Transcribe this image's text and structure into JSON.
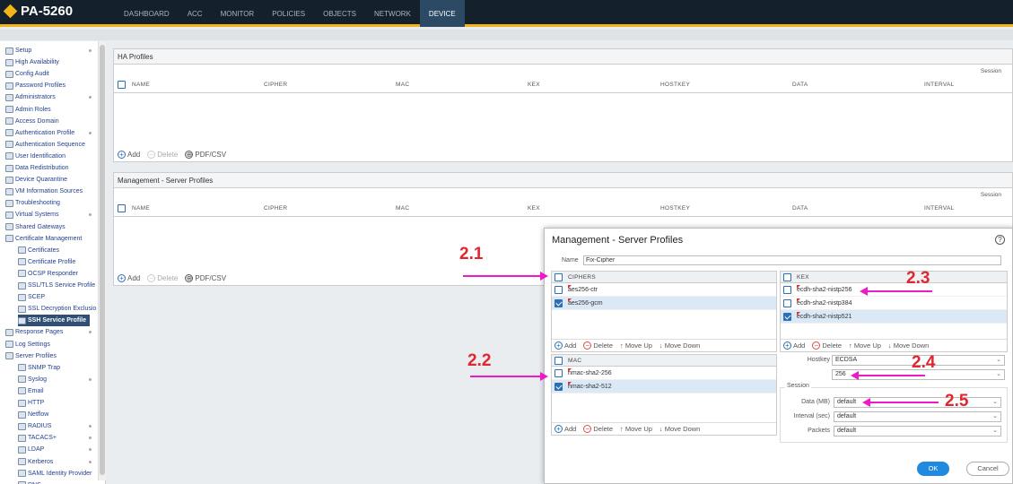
{
  "app": {
    "device_name": "PA-5260"
  },
  "nav": {
    "tabs": [
      "DASHBOARD",
      "ACC",
      "MONITOR",
      "POLICIES",
      "OBJECTS",
      "NETWORK",
      "DEVICE"
    ],
    "active": "DEVICE"
  },
  "sidebar": {
    "items": [
      {
        "label": "Setup"
      },
      {
        "label": "High Availability"
      },
      {
        "label": "Config Audit"
      },
      {
        "label": "Password Profiles"
      },
      {
        "label": "Administrators"
      },
      {
        "label": "Admin Roles"
      },
      {
        "label": "Access Domain"
      },
      {
        "label": "Authentication Profile"
      },
      {
        "label": "Authentication Sequence"
      },
      {
        "label": "User Identification"
      },
      {
        "label": "Data Redistribution"
      },
      {
        "label": "Device Quarantine"
      },
      {
        "label": "VM Information Sources"
      },
      {
        "label": "Troubleshooting"
      },
      {
        "label": "Virtual Systems"
      },
      {
        "label": "Shared Gateways"
      },
      {
        "label": "Certificate Management"
      },
      {
        "label": "Certificates"
      },
      {
        "label": "Certificate Profile"
      },
      {
        "label": "OCSP Responder"
      },
      {
        "label": "SSL/TLS Service Profile"
      },
      {
        "label": "SCEP"
      },
      {
        "label": "SSL Decryption Exclusio"
      },
      {
        "label": "SSH Service Profile"
      },
      {
        "label": "Response Pages"
      },
      {
        "label": "Log Settings"
      },
      {
        "label": "Server Profiles"
      },
      {
        "label": "SNMP Trap"
      },
      {
        "label": "Syslog"
      },
      {
        "label": "Email"
      },
      {
        "label": "HTTP"
      },
      {
        "label": "Netflow"
      },
      {
        "label": "RADIUS"
      },
      {
        "label": "TACACS+"
      },
      {
        "label": "LDAP"
      },
      {
        "label": "Kerberos"
      },
      {
        "label": "SAML Identity Provider"
      },
      {
        "label": "DNS"
      }
    ],
    "active": "SSH Service Profile"
  },
  "ha_panel": {
    "title": "HA Profiles"
  },
  "mgmt_panel": {
    "title": "Management - Server Profiles"
  },
  "table_columns": {
    "name": "NAME",
    "cipher": "CIPHER",
    "mac": "MAC",
    "kex": "KEX",
    "hostkey": "HOSTKEY",
    "data": "DATA",
    "interval": "INTERVAL",
    "session": "Session"
  },
  "footer_actions": {
    "add": "Add",
    "delete": "Delete",
    "pdf": "PDF/CSV"
  },
  "modal": {
    "title": "Management - Server Profiles",
    "name_label": "Name",
    "name_value": "Fix-Cipher",
    "ciphers": {
      "header": "CIPHERS",
      "rows": [
        {
          "value": "aes256-ctr",
          "checked": false
        },
        {
          "value": "aes256-gcm",
          "checked": true
        }
      ]
    },
    "kex": {
      "header": "KEX",
      "rows": [
        {
          "value": "ecdh-sha2-nistp256",
          "checked": false
        },
        {
          "value": "ecdh-sha2-nistp384",
          "checked": false
        },
        {
          "value": "ecdh-sha2-nistp521",
          "checked": true
        }
      ]
    },
    "mac": {
      "header": "MAC",
      "rows": [
        {
          "value": "hmac-sha2-256",
          "checked": false
        },
        {
          "value": "hmac-sha2-512",
          "checked": true
        }
      ]
    },
    "grid_actions": {
      "add": "Add",
      "delete": "Delete",
      "move_up": "Move Up",
      "move_down": "Move Down"
    },
    "hostkey_label": "Hostkey",
    "hostkey_value": "ECDSA",
    "hostkey_bits": "256",
    "session_title": "Session",
    "data_label": "Data (MB)",
    "data_value": "default",
    "interval_label": "Interval (sec)",
    "interval_value": "default",
    "packets_label": "Packets",
    "packets_value": "default",
    "ok_label": "OK",
    "cancel_label": "Cancel"
  },
  "annotations": [
    "2.1",
    "2.2",
    "2.3",
    "2.4",
    "2.5"
  ],
  "colors": {
    "accent": "#1f8ae0",
    "annotation_text": "#e0262e",
    "annotation_arrow": "#ee1ac8",
    "topbar": "#14212d",
    "topbar_border": "#f3b418"
  }
}
